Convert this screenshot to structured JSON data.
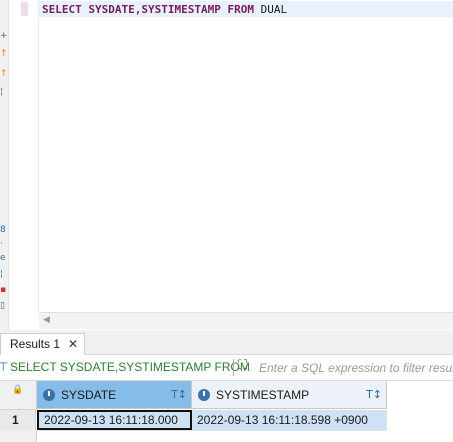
{
  "editor": {
    "sql_keyword_select": "SELECT",
    "sql_columns": "SYSDATE,SYSTIMESTAMP",
    "sql_keyword_from": "FROM",
    "sql_table": "DUAL"
  },
  "results_tab": {
    "label": "Results 1",
    "close_glyph": "✕"
  },
  "filter_bar": {
    "query_text": "SELECT SYSDATE,SYSTIMESTAMP FROM",
    "placeholder": "Enter a SQL expression to filter results"
  },
  "grid": {
    "columns": [
      {
        "label": "SYSDATE"
      },
      {
        "label": "SYSTIMESTAMP"
      }
    ],
    "rows": [
      {
        "num": "1",
        "cells": [
          "2022-09-13 16:11:18.000",
          "2022-09-13 16:11:18.598 +0900"
        ]
      }
    ]
  },
  "icons": {
    "filter": "filter-icon",
    "sort_filter": "column-filter-icon",
    "expand": "expand-icon",
    "lock": "lock-icon",
    "column_type": "clock-icon"
  },
  "colors": {
    "keyword": "#7a1c5a",
    "selected_header": "#86bde8",
    "selected_row": "#cfe2f5",
    "filter_query": "#2f7d2f"
  }
}
